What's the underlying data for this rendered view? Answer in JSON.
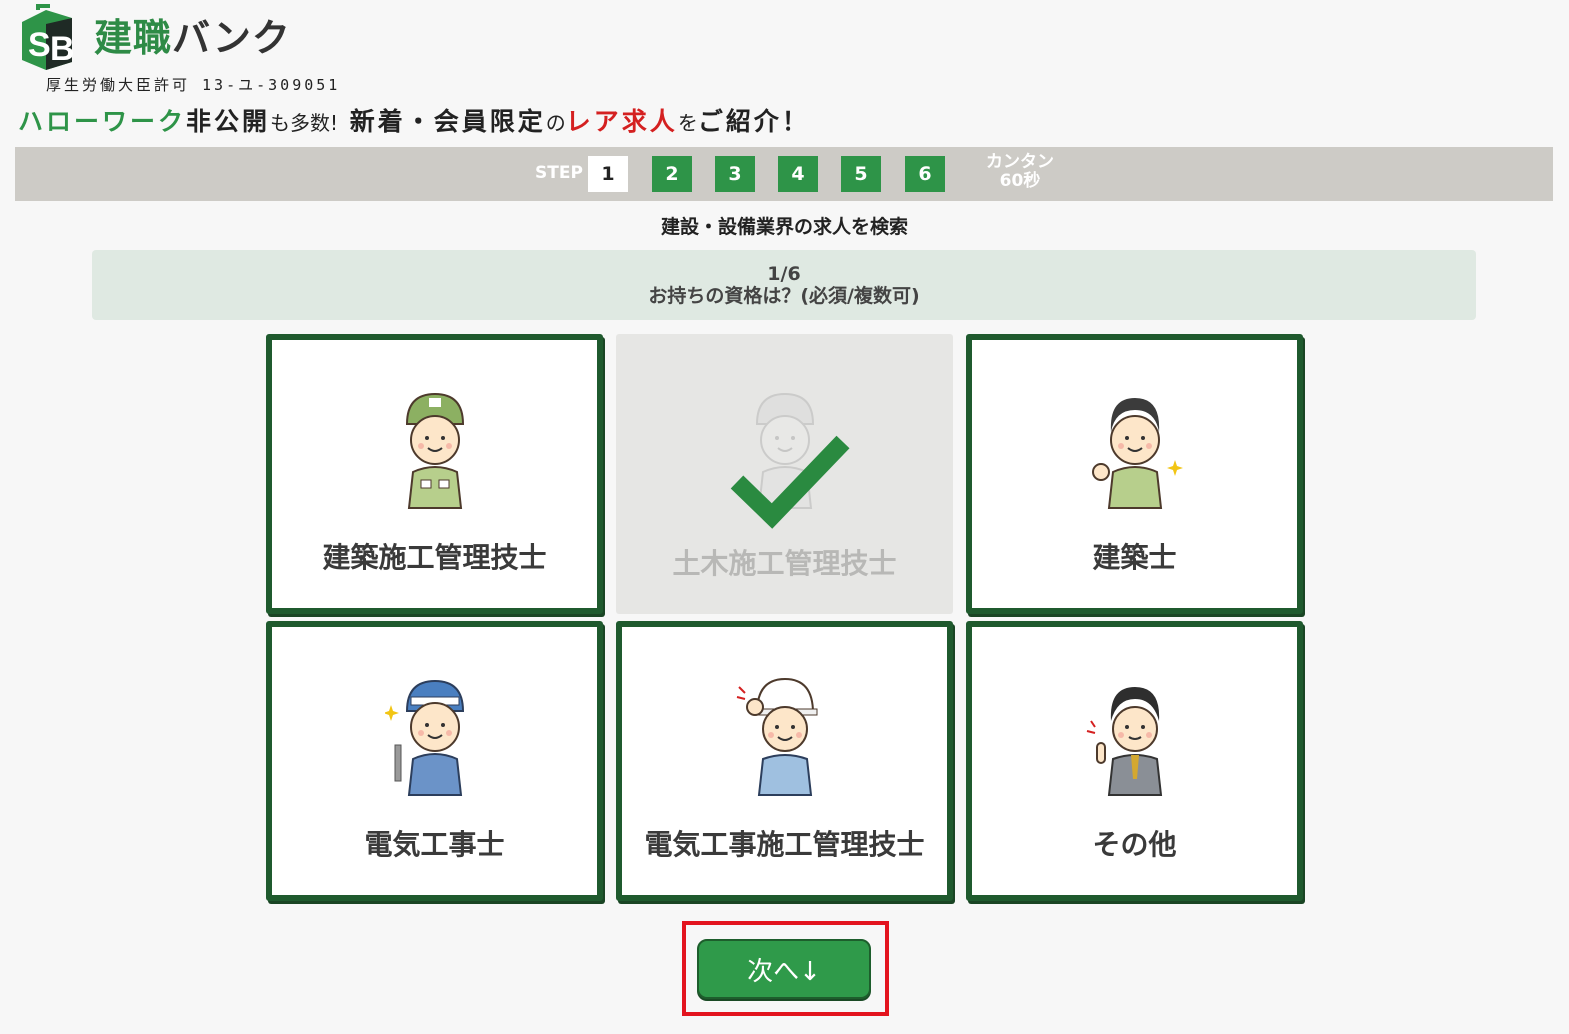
{
  "header": {
    "logo_kanji": "建職",
    "logo_kana": "バンク",
    "license": "厚生労働大臣許可 13-ユ-309051",
    "tagline": {
      "part1": "ハローワーク",
      "part2": "非公開",
      "part3": "も多数!",
      "part4": "新着・会員限定",
      "part5": "の",
      "part6": "レア求人",
      "part7": "を",
      "part8": "ご紹介！"
    }
  },
  "stepbar": {
    "label": "STEP",
    "steps": [
      "1",
      "2",
      "3",
      "4",
      "5",
      "6"
    ],
    "active_step": 1,
    "time_line1": "カンタン",
    "time_line2": "60秒"
  },
  "main": {
    "search_title": "建設・設備業界の求人を検索",
    "progress": "1/6",
    "question": "お持ちの資格は？(必須/複数可)"
  },
  "options": [
    {
      "label": "建築施工管理技士",
      "selected": false,
      "icon": "worker-cap-icon"
    },
    {
      "label": "土木施工管理技士",
      "selected": true,
      "icon": "worker-waving-icon"
    },
    {
      "label": "建築士",
      "selected": false,
      "icon": "worker-fist-icon"
    },
    {
      "label": "電気工事士",
      "selected": false,
      "icon": "worker-wrench-icon"
    },
    {
      "label": "電気工事施工管理技士",
      "selected": false,
      "icon": "worker-helmet-icon"
    },
    {
      "label": "その他",
      "selected": false,
      "icon": "businessman-icon"
    }
  ],
  "next_button": {
    "label": "次へ↓"
  },
  "colors": {
    "brand_green": "#2e9448",
    "card_border": "#1f5a2e",
    "accent_red": "#d42020",
    "highlight_red": "#e3141e"
  }
}
